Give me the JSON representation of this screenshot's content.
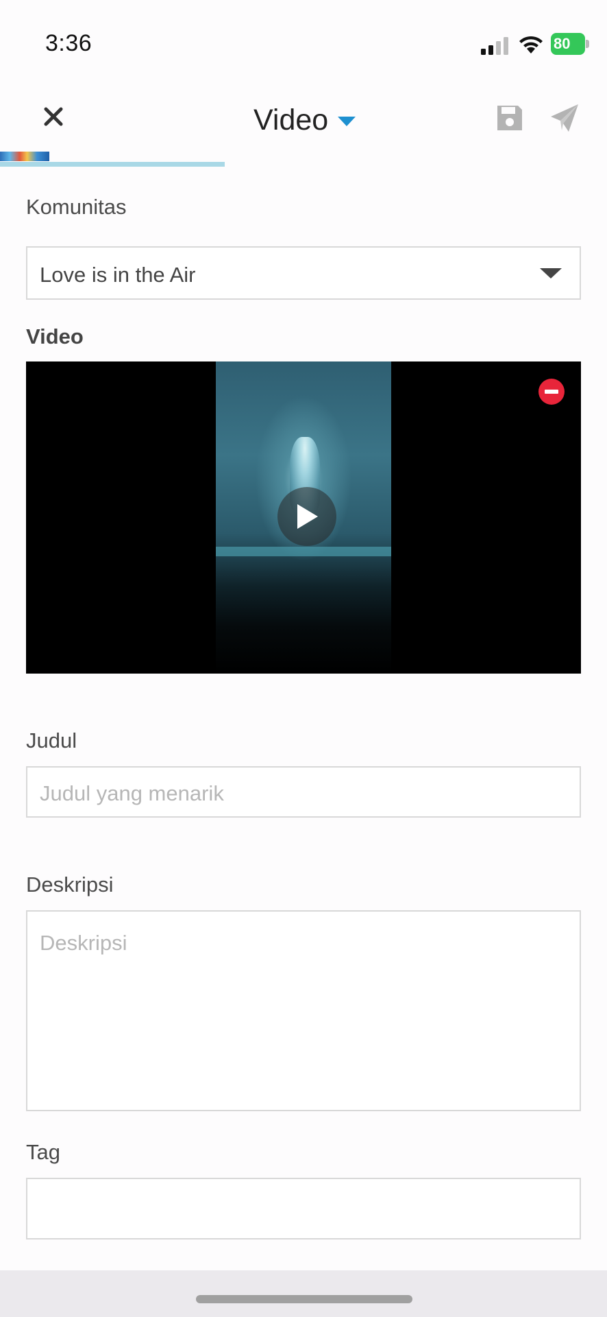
{
  "status_bar": {
    "time": "3:36",
    "battery": "80",
    "icons": [
      "signal-icon",
      "wifi-icon",
      "battery-icon"
    ]
  },
  "header": {
    "title": "Video",
    "icons": [
      "close-icon",
      "caret-down-icon",
      "save-icon",
      "send-icon"
    ],
    "accent_color": "#1e90d0"
  },
  "upload_progress": 0.37,
  "form": {
    "komunitas": {
      "label": "Komunitas",
      "value": "Love is in the Air"
    },
    "video": {
      "label": "Video"
    },
    "judul": {
      "label": "Judul",
      "placeholder": "Judul yang menarik",
      "value": ""
    },
    "deskripsi": {
      "label": "Deskripsi",
      "placeholder": "Deskripsi",
      "value": ""
    },
    "tag": {
      "label": "Tag",
      "value": ""
    }
  },
  "colors": {
    "remove": "#e8253a",
    "progress": "#a9d8e6",
    "battery": "#34c759"
  }
}
